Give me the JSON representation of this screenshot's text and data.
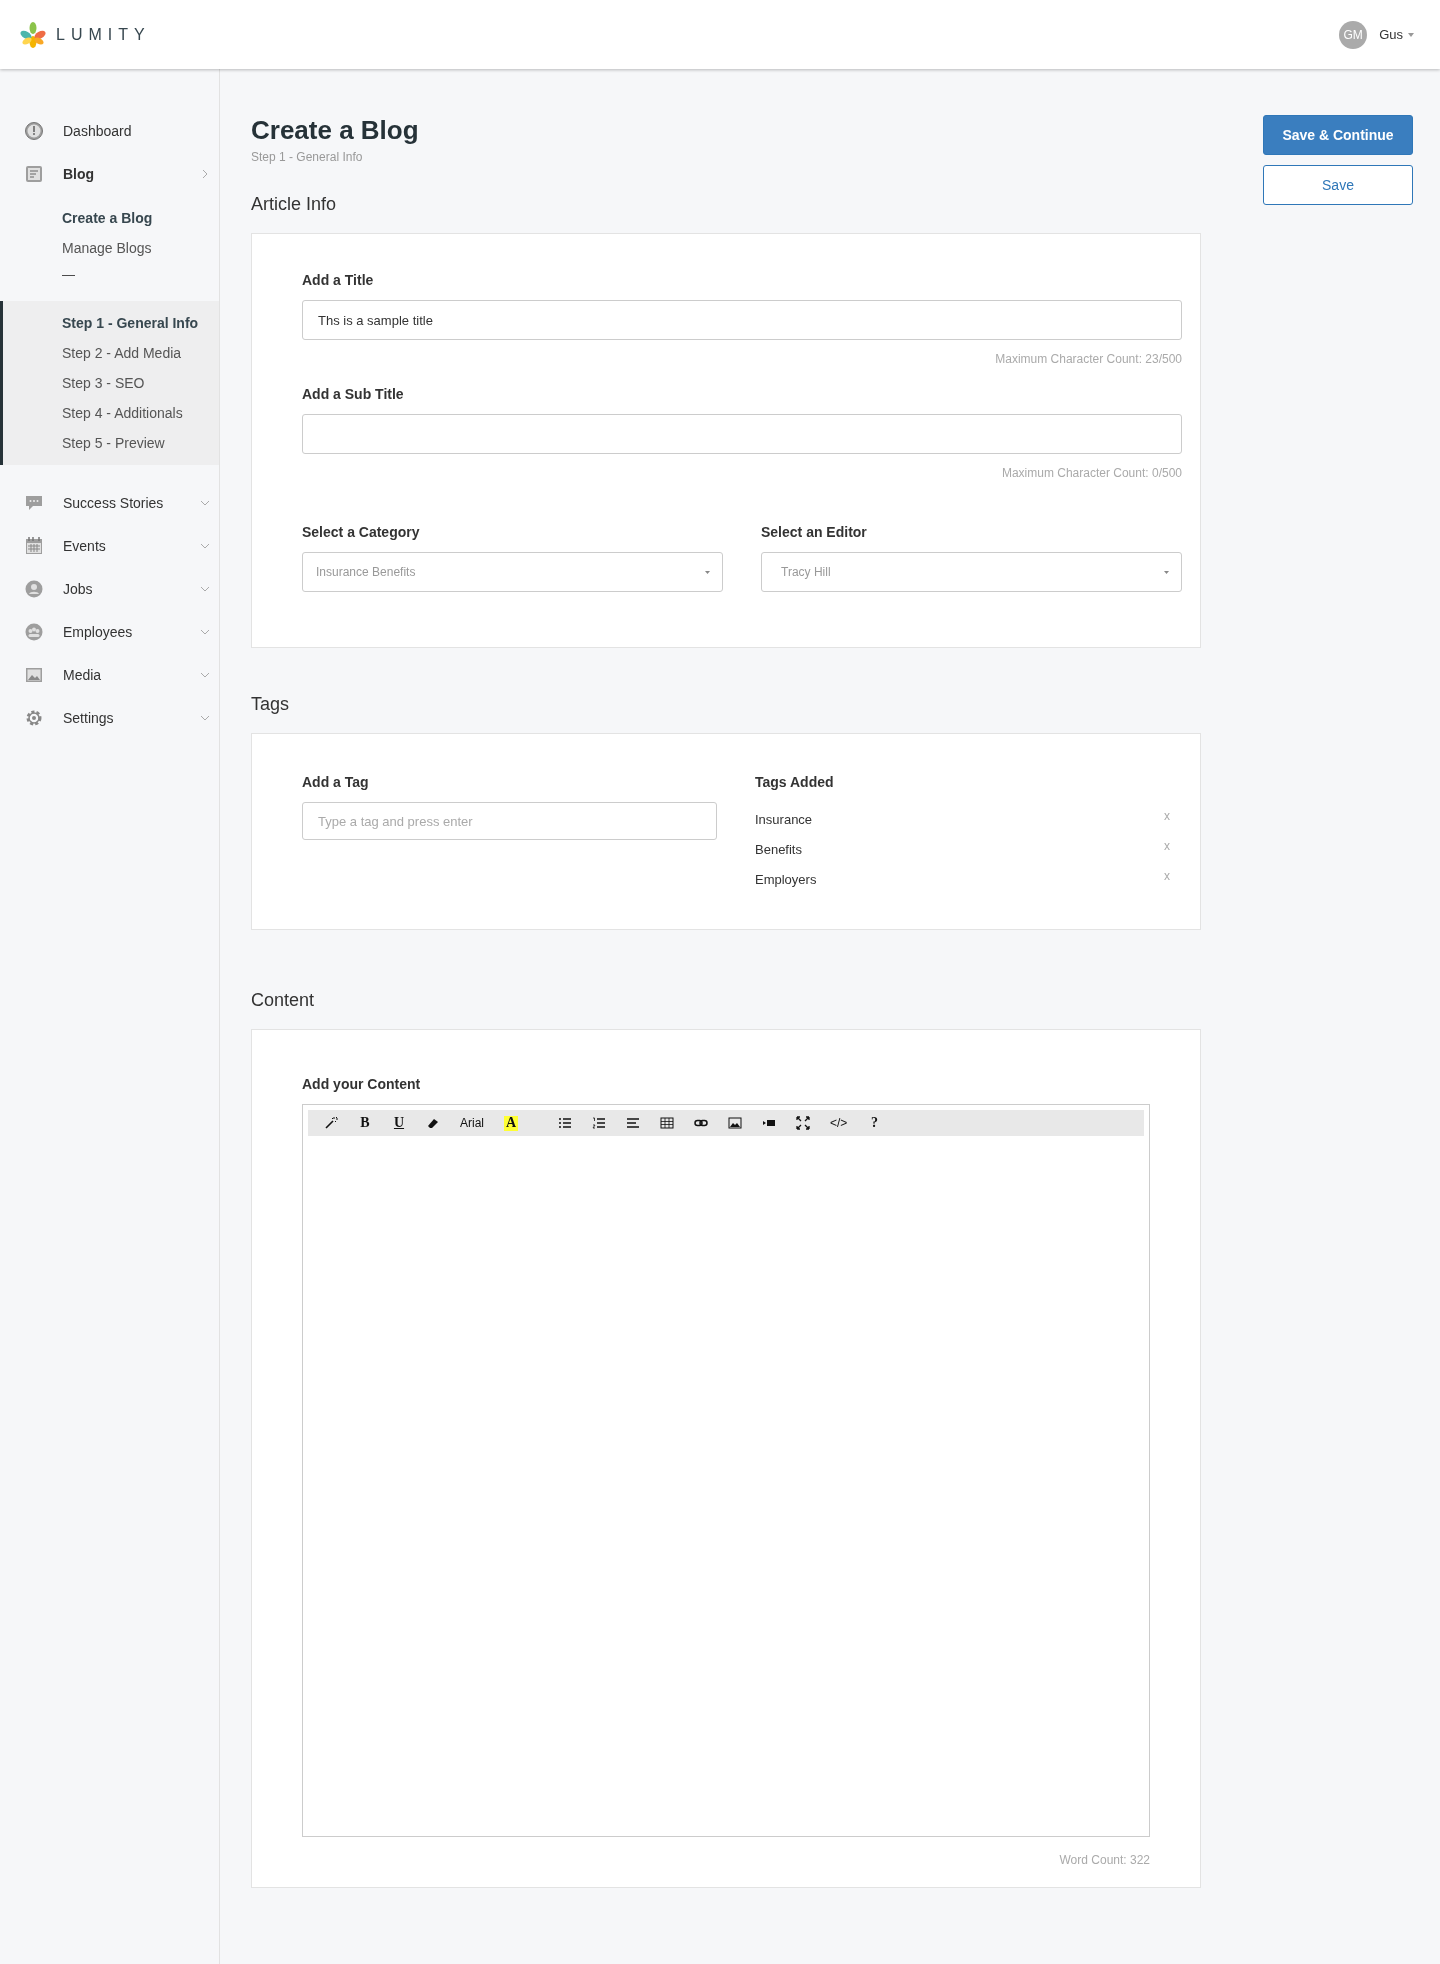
{
  "header": {
    "brand": "LUMITY",
    "user": {
      "initials": "GM",
      "name": "Gus"
    }
  },
  "sidebar": {
    "items": [
      {
        "label": "Dashboard",
        "selected": false
      },
      {
        "label": "Blog",
        "selected": true,
        "expanded": true,
        "children": [
          {
            "label": "Create a Blog",
            "selected": true
          },
          {
            "label": "Manage Blogs",
            "selected": false
          }
        ],
        "separator": "—",
        "steps": [
          {
            "label": "Step 1 - General Info",
            "selected": true
          },
          {
            "label": "Step 2 - Add Media",
            "selected": false
          },
          {
            "label": "Step 3 - SEO",
            "selected": false
          },
          {
            "label": "Step 4 - Additionals",
            "selected": false
          },
          {
            "label": "Step 5 - Preview",
            "selected": false
          }
        ]
      },
      {
        "label": "Success Stories",
        "selected": false,
        "expanded": false
      },
      {
        "label": "Events",
        "selected": false,
        "expanded": false
      },
      {
        "label": "Jobs",
        "selected": false,
        "expanded": false
      },
      {
        "label": "Employees",
        "selected": false,
        "expanded": false
      },
      {
        "label": "Media",
        "selected": false,
        "expanded": false
      },
      {
        "label": "Settings",
        "selected": false,
        "expanded": false
      }
    ]
  },
  "page": {
    "title": "Create a Blog",
    "subtitle": "Step 1 - General Info"
  },
  "actions": [
    {
      "label": "Save & Continue",
      "kind": "primary"
    },
    {
      "label": "Save",
      "kind": "secondary"
    }
  ],
  "article_info": {
    "heading": "Article Info",
    "title_field": {
      "label": "Add a Title",
      "value": "Ths is a sample title",
      "counter": "Maximum Character Count: 23/500"
    },
    "subtitle_field": {
      "label": "Add a Sub Title",
      "counter": "Maximum Character Count: 0/500"
    },
    "category": {
      "label": "Select a Category",
      "value": "Insurance Benefits"
    },
    "editor": {
      "label": "Select an Editor",
      "value": "Tracy Hill"
    }
  },
  "tags": {
    "heading": "Tags",
    "add_label": "Add a Tag",
    "placeholder": "Type a tag and press enter",
    "added_label": "Tags Added",
    "items": [
      {
        "label": "Insurance",
        "remove": "x"
      },
      {
        "label": "Benefits",
        "remove": "x"
      },
      {
        "label": "Employers",
        "remove": "x"
      }
    ]
  },
  "content": {
    "heading": "Content",
    "label": "Add your Content",
    "toolbar": [
      {
        "kind": "icon"
      },
      {
        "kind": "bold",
        "label": "B"
      },
      {
        "kind": "underline",
        "label": "U"
      },
      {
        "kind": "icon"
      },
      {
        "kind": "plain",
        "label": "Arial"
      },
      {
        "kind": "highlight",
        "label": "A"
      },
      {
        "kind": "icon"
      },
      {
        "kind": "icon"
      },
      {
        "kind": "icon"
      },
      {
        "kind": "icon"
      },
      {
        "kind": "icon"
      },
      {
        "kind": "icon"
      },
      {
        "kind": "icon"
      },
      {
        "kind": "icon"
      },
      {
        "kind": "plain",
        "label": "</>"
      },
      {
        "kind": "bold",
        "label": "?"
      }
    ],
    "word_count": "Word Count: 322"
  }
}
